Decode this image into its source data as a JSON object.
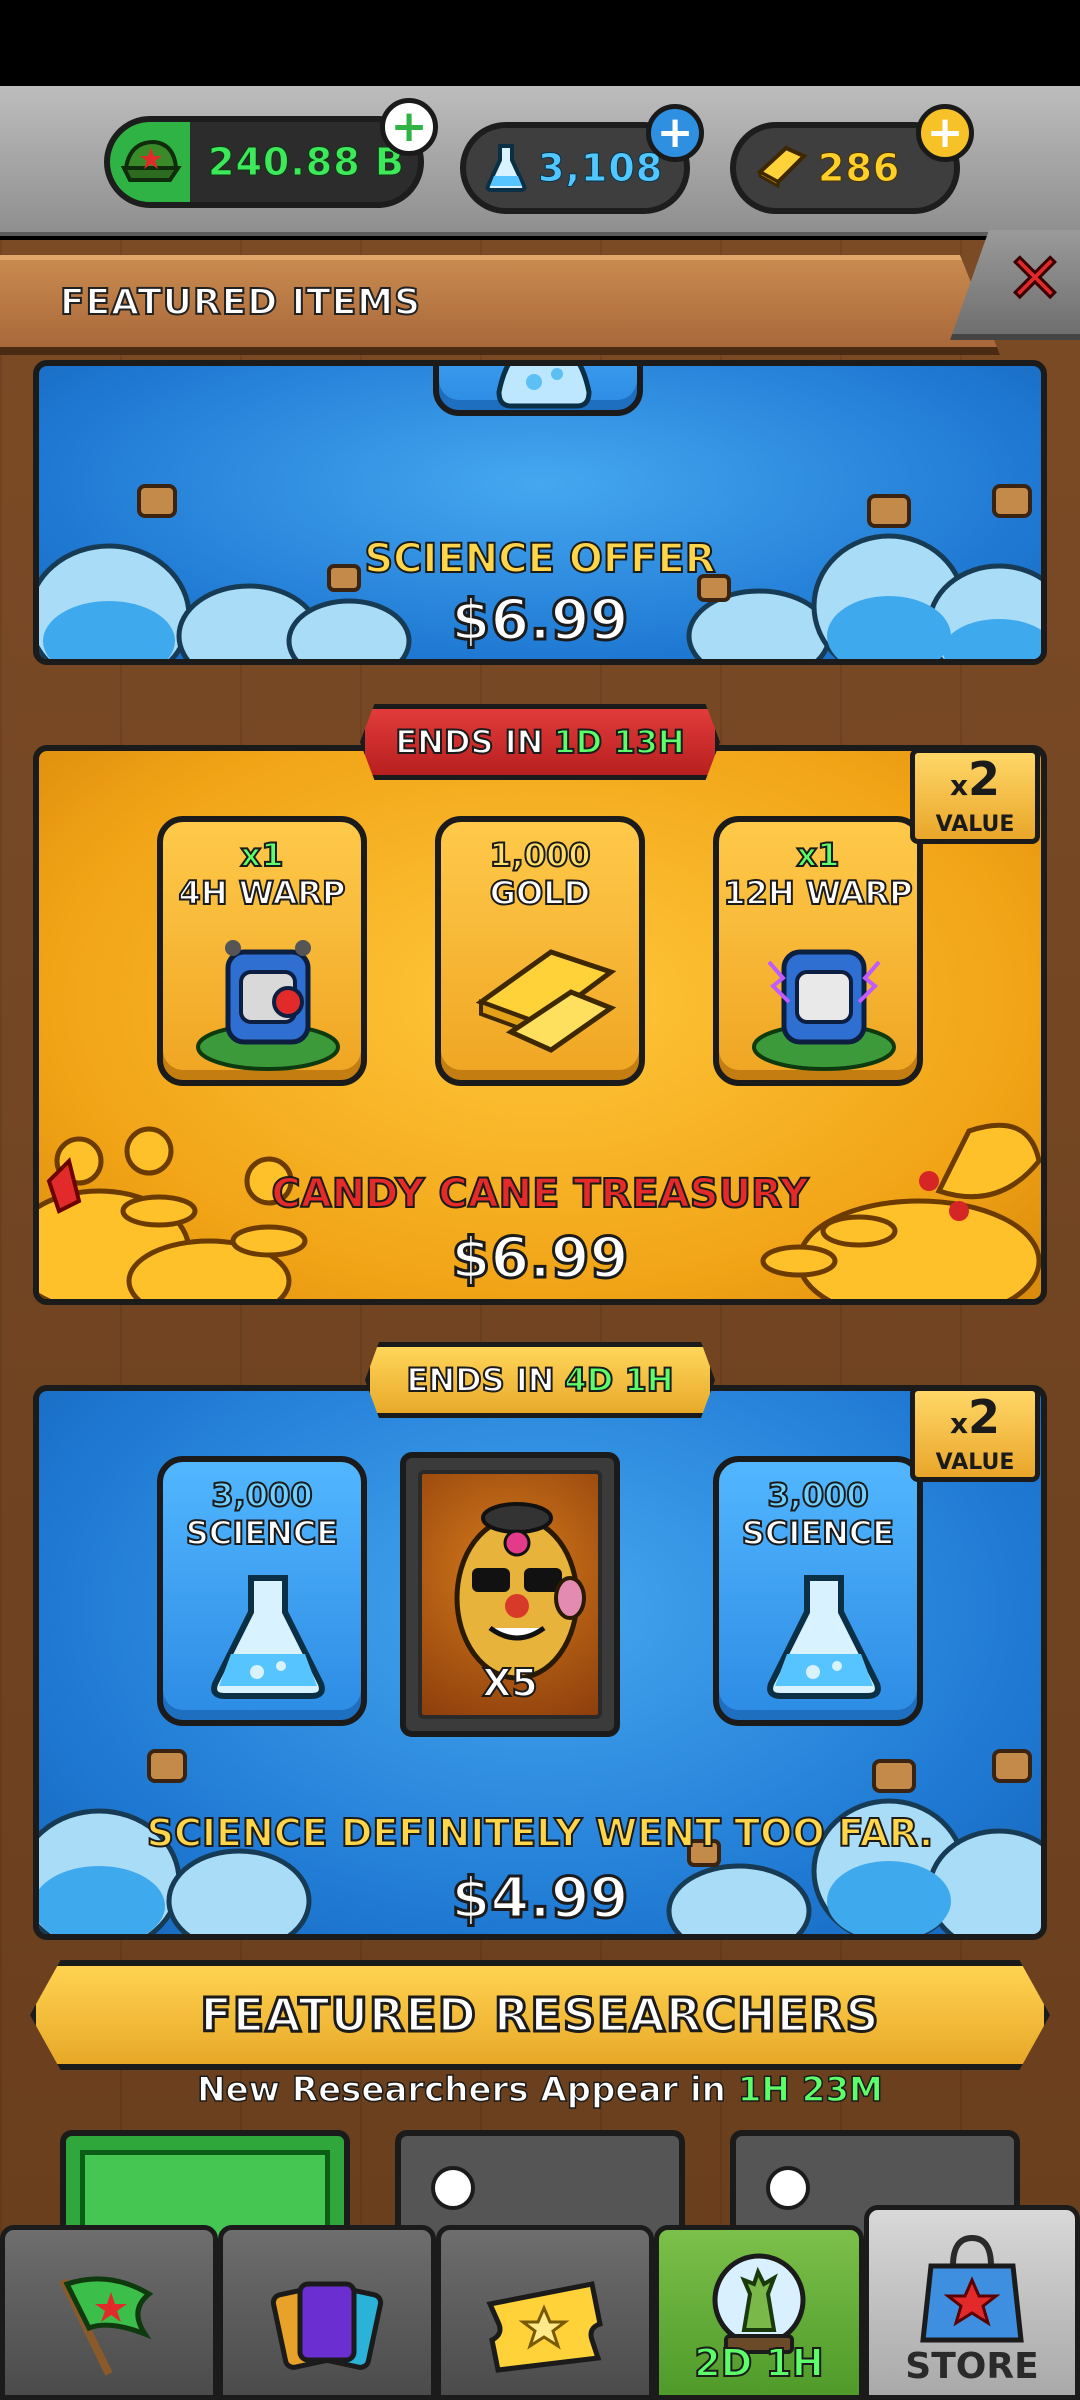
{
  "currencies": {
    "cash": "240.88 B",
    "science": "3,108",
    "gold": "286"
  },
  "panel": {
    "title": "FEATURED ITEMS",
    "close_icon": "close-icon"
  },
  "offers": [
    {
      "name": "SCIENCE OFFER",
      "price": "$6.99",
      "name_color": "#ffd54a"
    },
    {
      "banner_prefix": "ENDS IN",
      "banner_time": "1D 13H",
      "value_mult": "2",
      "value_prefix": "x",
      "value_label": "VALUE",
      "items": [
        {
          "qty": "x1",
          "label": "4H WARP",
          "icon": "warp-backpack-icon"
        },
        {
          "qty": "1,000",
          "label": "GOLD",
          "icon": "gold-bars-icon"
        },
        {
          "qty": "x1",
          "label": "12H WARP",
          "icon": "warp-backpack-icon"
        }
      ],
      "name": "CANDY CANE TREASURY",
      "price": "$6.99",
      "name_color": "#e52a2a"
    },
    {
      "banner_prefix": "ENDS IN",
      "banner_time": "4D 1H",
      "value_mult": "2",
      "value_prefix": "x",
      "value_label": "VALUE",
      "items": [
        {
          "qty": "3,000",
          "label": "SCIENCE",
          "icon": "science-flask-icon"
        },
        {
          "count": "X5",
          "icon": "researcher-portrait-icon"
        },
        {
          "qty": "3,000",
          "label": "SCIENCE",
          "icon": "science-flask-icon"
        }
      ],
      "name": "SCIENCE DEFINITELY WENT TOO FAR.",
      "price": "$4.99",
      "name_color": "#ffd54a"
    }
  ],
  "featured_researchers": {
    "title": "FEATURED RESEARCHERS",
    "subtitle_prefix": "New Researchers Appear in",
    "subtitle_hours": "1H",
    "subtitle_minutes": "23M"
  },
  "bottom_nav": [
    {
      "icon": "flag-icon",
      "label": ""
    },
    {
      "icon": "cards-icon",
      "label": ""
    },
    {
      "icon": "ticket-star-icon",
      "label": ""
    },
    {
      "icon": "zombie-globe-icon",
      "label": "2D 1H"
    },
    {
      "icon": "store-bag-icon",
      "label": "STORE"
    }
  ]
}
